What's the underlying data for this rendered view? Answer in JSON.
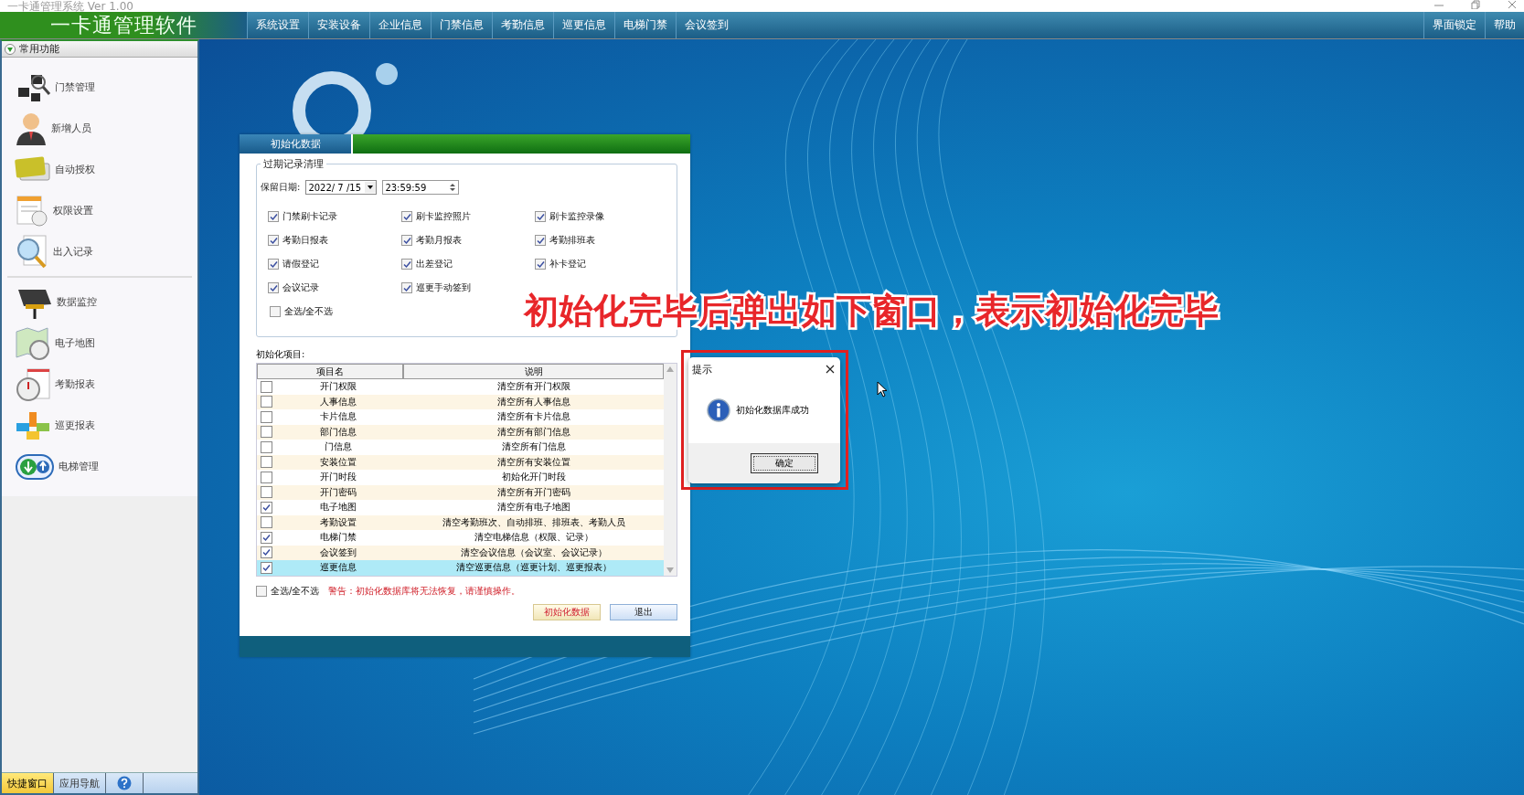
{
  "window": {
    "title": "一卡通管理系统 Ver 1.00"
  },
  "app_title": "一卡通管理软件",
  "menu": [
    "系统设置",
    "安装设备",
    "企业信息",
    "门禁信息",
    "考勤信息",
    "巡更信息",
    "电梯门禁",
    "会议签到"
  ],
  "menu_right": [
    "界面锁定",
    "帮助"
  ],
  "sidebar": {
    "header": "常用功能",
    "groups": [
      [
        {
          "label": "门禁管理"
        },
        {
          "label": "新增人员"
        },
        {
          "label": "自动授权"
        },
        {
          "label": "权限设置"
        },
        {
          "label": "出入记录"
        }
      ],
      [
        {
          "label": "数据监控"
        },
        {
          "label": "电子地图"
        },
        {
          "label": "考勤报表"
        },
        {
          "label": "巡更报表"
        },
        {
          "label": "电梯管理"
        }
      ]
    ]
  },
  "sidebar_tabs": [
    {
      "label": "快捷窗口",
      "selected": true
    },
    {
      "label": "应用导航",
      "selected": false
    }
  ],
  "dialog": {
    "title": "初始化数据",
    "cleanup": {
      "legend": "过期记录清理",
      "date_label": "保留日期:",
      "date": "2022/ 7 /15",
      "time": "23:59:59",
      "options": [
        {
          "label": "门禁刷卡记录",
          "checked": true
        },
        {
          "label": "刷卡监控照片",
          "checked": true
        },
        {
          "label": "刷卡监控录像",
          "checked": true
        },
        {
          "label": "考勤日报表",
          "checked": true
        },
        {
          "label": "考勤月报表",
          "checked": true
        },
        {
          "label": "考勤排班表",
          "checked": true
        },
        {
          "label": "请假登记",
          "checked": true
        },
        {
          "label": "出差登记",
          "checked": true
        },
        {
          "label": "补卡登记",
          "checked": true
        },
        {
          "label": "会议记录",
          "checked": true
        },
        {
          "label": "巡更手动签到",
          "checked": true
        }
      ],
      "select_all": {
        "label": "全选/全不选",
        "checked": false
      }
    },
    "items_label": "初始化项目:",
    "table": {
      "columns": [
        "项目名",
        "说明"
      ],
      "rows": [
        {
          "name": "开门权限",
          "description": "清空所有开门权限",
          "checked": false,
          "selected": false
        },
        {
          "name": "人事信息",
          "description": "清空所有人事信息",
          "checked": false,
          "selected": false
        },
        {
          "name": "卡片信息",
          "description": "清空所有卡片信息",
          "checked": false,
          "selected": false
        },
        {
          "name": "部门信息",
          "description": "清空所有部门信息",
          "checked": false,
          "selected": false
        },
        {
          "name": "门信息",
          "description": "清空所有门信息",
          "checked": false,
          "selected": false
        },
        {
          "name": "安装位置",
          "description": "清空所有安装位置",
          "checked": false,
          "selected": false
        },
        {
          "name": "开门时段",
          "description": "初始化开门时段",
          "checked": false,
          "selected": false
        },
        {
          "name": "开门密码",
          "description": "清空所有开门密码",
          "checked": false,
          "selected": false
        },
        {
          "name": "电子地图",
          "description": "清空所有电子地图",
          "checked": true,
          "selected": false
        },
        {
          "name": "考勤设置",
          "description": "清空考勤班次、自动排班、排班表、考勤人员",
          "checked": false,
          "selected": false
        },
        {
          "name": "电梯门禁",
          "description": "清空电梯信息（权限、记录）",
          "checked": true,
          "selected": false
        },
        {
          "name": "会议签到",
          "description": "清空会议信息（会议室、会议记录）",
          "checked": true,
          "selected": false
        },
        {
          "name": "巡更信息",
          "description": "清空巡更信息（巡更计划、巡更报表）",
          "checked": true,
          "selected": true
        }
      ]
    },
    "select_all": {
      "label": "全选/全不选",
      "checked": false
    },
    "warning": "警告：初始化数据库将无法恢复，请谨慎操作。",
    "buttons": [
      {
        "label": "初始化数据",
        "kind": "primary"
      },
      {
        "label": "退出",
        "kind": "default"
      }
    ]
  },
  "message_box": {
    "title": "提示",
    "message": "初始化数据库成功",
    "button": "确定"
  },
  "annotation": "初始化完毕后弹出如下窗口，表示初始化完毕"
}
